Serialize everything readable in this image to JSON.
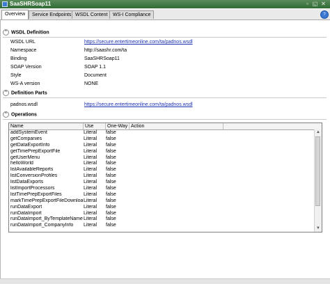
{
  "window": {
    "title": "SaaSHRSoap11",
    "icon": "window-app-icon"
  },
  "tabs": [
    {
      "label": "Overview",
      "active": true
    },
    {
      "label": "Service Endpoints",
      "active": false
    },
    {
      "label": "WSDL Content",
      "active": false
    },
    {
      "label": "WS-I Compliance",
      "active": false
    }
  ],
  "help_label": "?",
  "wsdl_definition": {
    "title": "WSDL Definition",
    "rows": [
      {
        "label": "WSDL URL",
        "value": "https://secure.entertimeonline.com/ta/padnos.wsdl",
        "link": true
      },
      {
        "label": "Namespace",
        "value": "http://saashr.com/ta",
        "link": false
      },
      {
        "label": "Binding",
        "value": "SaaSHRSoap11",
        "link": false
      },
      {
        "label": "SOAP Version",
        "value": "SOAP 1.1",
        "link": false
      },
      {
        "label": "Style",
        "value": "Document",
        "link": false
      },
      {
        "label": "WS-A version",
        "value": "NONE",
        "link": false
      }
    ]
  },
  "definition_parts": {
    "title": "Definition Parts",
    "rows": [
      {
        "label": "padnos.wsdl",
        "value": "https://secure.entertimeonline.com/ta/padnos.wsdl",
        "link": true
      }
    ]
  },
  "operations": {
    "title": "Operations",
    "columns": [
      "Name",
      "Use",
      "One-Way",
      "Action"
    ],
    "rows": [
      {
        "name": "addSystemEvent",
        "use": "Literal",
        "oneway": "false",
        "action": ""
      },
      {
        "name": "getCompanies",
        "use": "Literal",
        "oneway": "false",
        "action": ""
      },
      {
        "name": "getDataExportInfo",
        "use": "Literal",
        "oneway": "false",
        "action": ""
      },
      {
        "name": "getTimePrepExportFile",
        "use": "Literal",
        "oneway": "false",
        "action": ""
      },
      {
        "name": "getUserMenu",
        "use": "Literal",
        "oneway": "false",
        "action": ""
      },
      {
        "name": "helloWorld",
        "use": "Literal",
        "oneway": "false",
        "action": ""
      },
      {
        "name": "listAvailableReports",
        "use": "Literal",
        "oneway": "false",
        "action": ""
      },
      {
        "name": "listConversionProfiles",
        "use": "Literal",
        "oneway": "false",
        "action": ""
      },
      {
        "name": "listDataExports",
        "use": "Literal",
        "oneway": "false",
        "action": ""
      },
      {
        "name": "listImportProcessors",
        "use": "Literal",
        "oneway": "false",
        "action": ""
      },
      {
        "name": "listTimePrepExportFiles",
        "use": "Literal",
        "oneway": "false",
        "action": ""
      },
      {
        "name": "markTimePrepExportFileDownloa...",
        "use": "Literal",
        "oneway": "false",
        "action": ""
      },
      {
        "name": "runDataExport",
        "use": "Literal",
        "oneway": "false",
        "action": ""
      },
      {
        "name": "runDataImport",
        "use": "Literal",
        "oneway": "false",
        "action": ""
      },
      {
        "name": "runDataImport_ByTemplateName",
        "use": "Literal",
        "oneway": "false",
        "action": ""
      },
      {
        "name": "runDataImport_CompanyInfo",
        "use": "Literal",
        "oneway": "false",
        "action": ""
      }
    ]
  }
}
